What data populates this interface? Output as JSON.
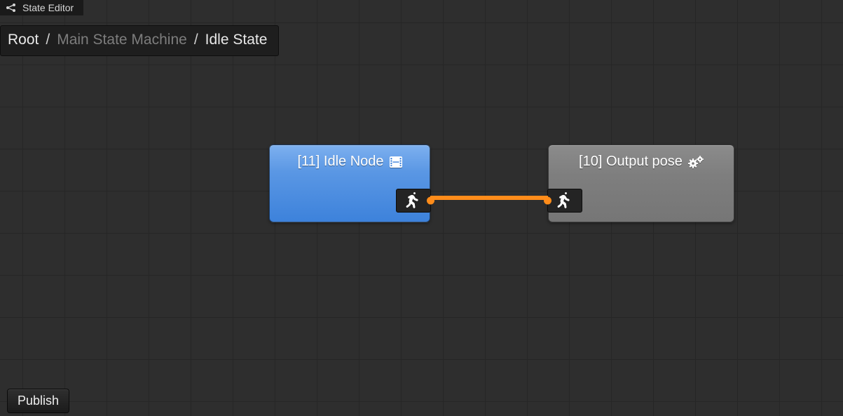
{
  "header": {
    "title": "State Editor"
  },
  "breadcrumbs": {
    "root": "Root",
    "mid": "Main State Machine",
    "leaf": "Idle State",
    "sep": "/"
  },
  "nodes": {
    "idle": {
      "title": "[11] Idle Node",
      "icon": "film-icon"
    },
    "output": {
      "title": "[10] Output pose",
      "icon": "gears-icon"
    },
    "port_icon": "running-man-icon"
  },
  "connection": {
    "from": "idle.output",
    "to": "output.input",
    "color": "#ff8c1a"
  },
  "buttons": {
    "publish": "Publish"
  }
}
